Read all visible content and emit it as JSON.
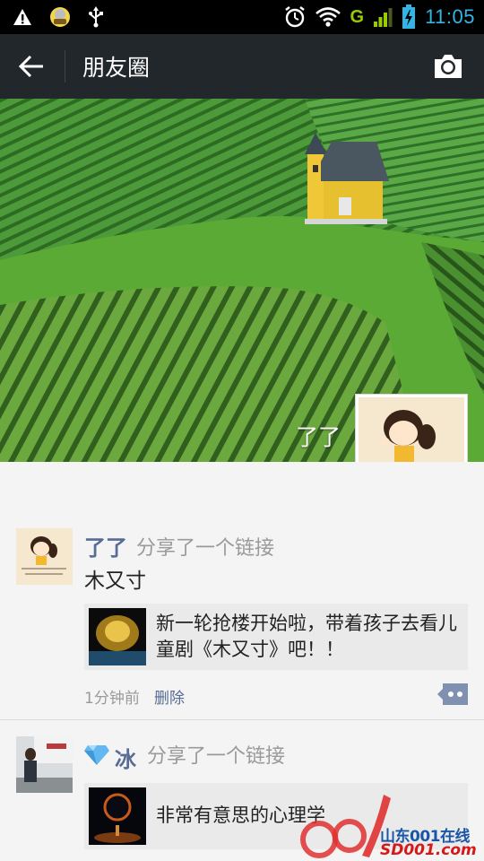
{
  "status_bar": {
    "network_label": "G",
    "time": "11:05",
    "time_color": "#33b5e5",
    "icons": [
      "warning-icon",
      "app-notification-icon",
      "usb-icon",
      "alarm-icon",
      "wifi-icon",
      "signal-icon",
      "battery-icon"
    ]
  },
  "title_bar": {
    "title": "朋友圈",
    "back_icon": "arrow-left-icon",
    "camera_icon": "camera-icon",
    "background": "#22272b"
  },
  "cover": {
    "user_name": "了了"
  },
  "posts": [
    {
      "user_name": "了了",
      "action": "分享了一个链接",
      "text": "木又寸",
      "link_title": "新一轮抢楼开始啦，带着孩子去看儿童剧《木又寸》吧！！",
      "time": "1分钟前",
      "delete_label": "删除"
    },
    {
      "user_name": "冰",
      "action": "分享了一个链接",
      "link_title": "非常有意思的心理学"
    }
  ],
  "watermark": {
    "text_cn": "山东001在线",
    "text_en": "SD001.com"
  },
  "colors": {
    "name_link": "#576b95",
    "gray_text": "#9a9a9a",
    "feed_bg": "#f4f4f4"
  }
}
